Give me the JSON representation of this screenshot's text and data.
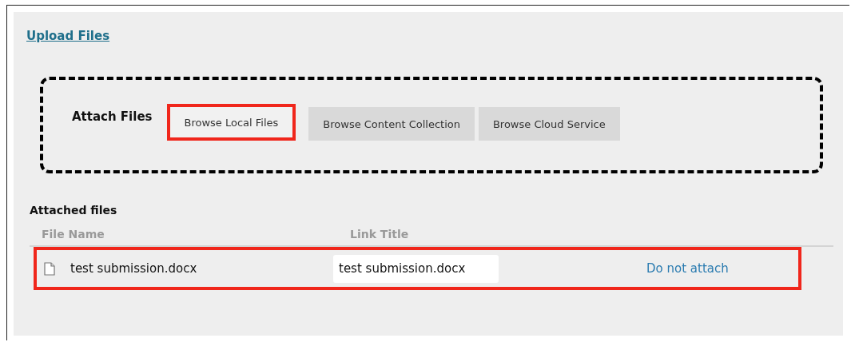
{
  "upload_link": "Upload Files",
  "attach": {
    "label": "Attach Files",
    "buttons": [
      {
        "label": "Browse Local Files",
        "highlighted": true
      },
      {
        "label": "Browse Content Collection",
        "highlighted": false
      },
      {
        "label": "Browse Cloud Service",
        "highlighted": false
      }
    ]
  },
  "attached_files": {
    "title": "Attached files",
    "columns": [
      "File Name",
      "Link Title"
    ],
    "rows": [
      {
        "file_name": "test submission.docx",
        "link_title": "test submission.docx",
        "action": "Do not attach",
        "highlighted": true
      }
    ]
  }
}
